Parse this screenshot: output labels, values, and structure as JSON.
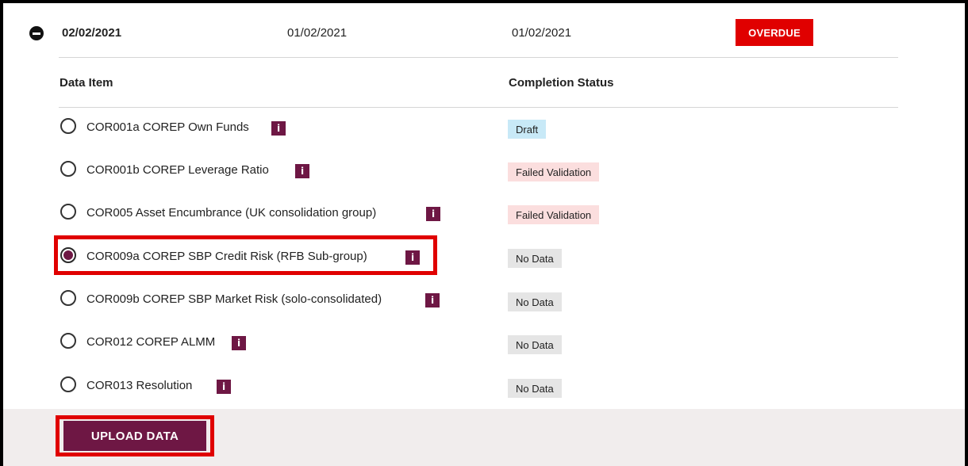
{
  "header": {
    "date_primary": "02/02/2021",
    "date_secondary": "01/02/2021",
    "date_tertiary": "01/02/2021",
    "badge": "OVERDUE"
  },
  "table": {
    "col_item": "Data Item",
    "col_status": "Completion Status",
    "rows": [
      {
        "label": "COR001a COREP Own Funds",
        "status": "Draft",
        "status_type": "draft",
        "selected": false
      },
      {
        "label": "COR001b COREP Leverage Ratio",
        "status": "Failed Validation",
        "status_type": "failed",
        "selected": false
      },
      {
        "label": "COR005 Asset Encumbrance (UK consolidation group)",
        "status": "Failed Validation",
        "status_type": "failed",
        "selected": false
      },
      {
        "label": "COR009a COREP SBP Credit Risk (RFB Sub-group)",
        "status": "No Data",
        "status_type": "nodata",
        "selected": true
      },
      {
        "label": "COR009b COREP SBP Market Risk (solo-consolidated)",
        "status": "No Data",
        "status_type": "nodata",
        "selected": false
      },
      {
        "label": "COR012 COREP ALMM",
        "status": "No Data",
        "status_type": "nodata",
        "selected": false
      },
      {
        "label": "COR013 Resolution",
        "status": "No Data",
        "status_type": "nodata",
        "selected": false
      }
    ],
    "info_glyph": "i"
  },
  "footer": {
    "upload_label": "UPLOAD DATA"
  },
  "colors": {
    "accent": "#6e1744",
    "alert": "#e00000",
    "draft": "#c8e9f7",
    "failed": "#fbdede",
    "nodata": "#e5e5e5"
  }
}
